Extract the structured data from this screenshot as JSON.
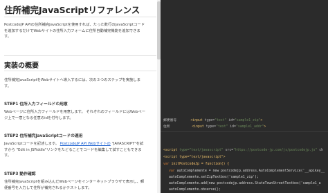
{
  "doc": {
    "title": "住所補完JavaScriptリファレンス",
    "intro1": "PostcodeJP APIの住所補完JavaScriptを使用すれば、たった数行のJavaScriptコード",
    "intro2": "を追加するだけでWebサイトの住所入力フォームに住所自動補完機能を追加できま",
    "intro3": "す。",
    "section_title": "実装の概要",
    "overview": "住所補完JavaScriptをWebサイトへ導入するには、次の３つのステップを実施しま",
    "overview2": "す。",
    "step1_title": "STEP1 住所入力フィールドの用意",
    "step1_text1": "Webページに住所入力フィールドを用意します。 それぞれのフィールドにはWebペー",
    "step1_text2": "ジ上で一意となる任意のidを付与します。",
    "step2_title": "STEP2 住所補完JavaScriptコードの適用",
    "step2_text_a": "JavaScriptコードを記述します。",
    "step2_link": "PostcodeJP API Webサイトの",
    "step2_text_b": "\"JAVASCRIPT\"を試",
    "step2_text2": "すから \"Edit in JSFiddle\"リンクをたどることでコードを編集して試すこともできま",
    "step2_text3": "す。",
    "step3_title": "STEP3 動作確認",
    "step3_text1": "住所補完JavaScriptを組み込んだWebページをインターネットブラウザで表示し、郵",
    "step3_text2": "便番号を入力して住所が補完されるかテストします。"
  },
  "code": {
    "html1_label": "郵便番号",
    "html1_tag": "<input",
    "html1_type_attr": "type=",
    "html1_type_val": "\"text\"",
    "html1_id_attr": "id=",
    "html1_id_val": "\"sample1_zip\"",
    "html1_end": ">",
    "html2_label": "住所",
    "html2_tag": "<input",
    "html2_type_attr": "type=",
    "html2_type_val": "\"text\"",
    "html2_id_attr": "id=",
    "html2_id_val": "\"sample1_addr\"",
    "html2_end": ">",
    "js_line1_open": "<script",
    "js_line1_type": "type=\"text/javascript\"",
    "js_line1_src_attr": "src=",
    "js_line1_src_val": "\"https://postcode-jp.com/js/postcodejp.js\"",
    "js_line1_rest": "ch",
    "js_line2": "<script type=\"text/javascript\">",
    "js_line3_kw": "var",
    "js_line3_rest": "initPostcodeJp = function() {",
    "js_line4_kw": "var",
    "js_line4_rest": "autoComplemente = new postcodejp.address.AutoComplementService('__apikey__",
    "js_line5": "autoComplemente.setZipTextbox('sample1_zip');",
    "js_line6_kw": "autoComplemente.add(new",
    "js_line6_rest": "postcodejp.address.StateTownStreetTextbox('sample1_a",
    "js_line7": "autoComplemente.observe();"
  }
}
